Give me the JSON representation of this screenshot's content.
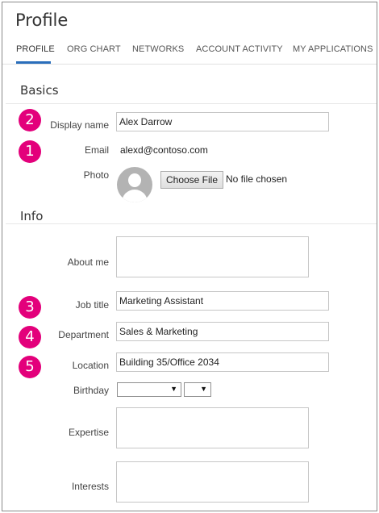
{
  "page": {
    "title": "Profile"
  },
  "tabs": [
    {
      "label": "PROFILE",
      "active": true
    },
    {
      "label": "ORG CHART",
      "active": false
    },
    {
      "label": "NETWORKS",
      "active": false
    },
    {
      "label": "ACCOUNT ACTIVITY",
      "active": false
    },
    {
      "label": "MY APPLICATIONS",
      "active": false
    }
  ],
  "sections": {
    "basics": "Basics",
    "info": "Info"
  },
  "callouts": [
    "2",
    "1",
    "3",
    "4",
    "5"
  ],
  "fields": {
    "display_name": {
      "label": "Display name",
      "value": "Alex Darrow"
    },
    "email": {
      "label": "Email",
      "value": "alexd@contoso.com"
    },
    "photo": {
      "label": "Photo",
      "button": "Choose File",
      "status": "No file chosen"
    },
    "about_me": {
      "label": "About me",
      "value": ""
    },
    "job_title": {
      "label": "Job title",
      "value": "Marketing Assistant"
    },
    "department": {
      "label": "Department",
      "value": "Sales & Marketing"
    },
    "location": {
      "label": "Location",
      "value": "Building 35/Office 2034"
    },
    "birthday": {
      "label": "Birthday",
      "month": "",
      "day": ""
    },
    "expertise": {
      "label": "Expertise",
      "value": ""
    },
    "interests": {
      "label": "Interests",
      "value": ""
    }
  },
  "colors": {
    "accent": "#2a6ebb",
    "callout": "#e3007b"
  },
  "icons": {
    "avatar": "default-person-avatar",
    "dropdown": "triangle-down"
  }
}
